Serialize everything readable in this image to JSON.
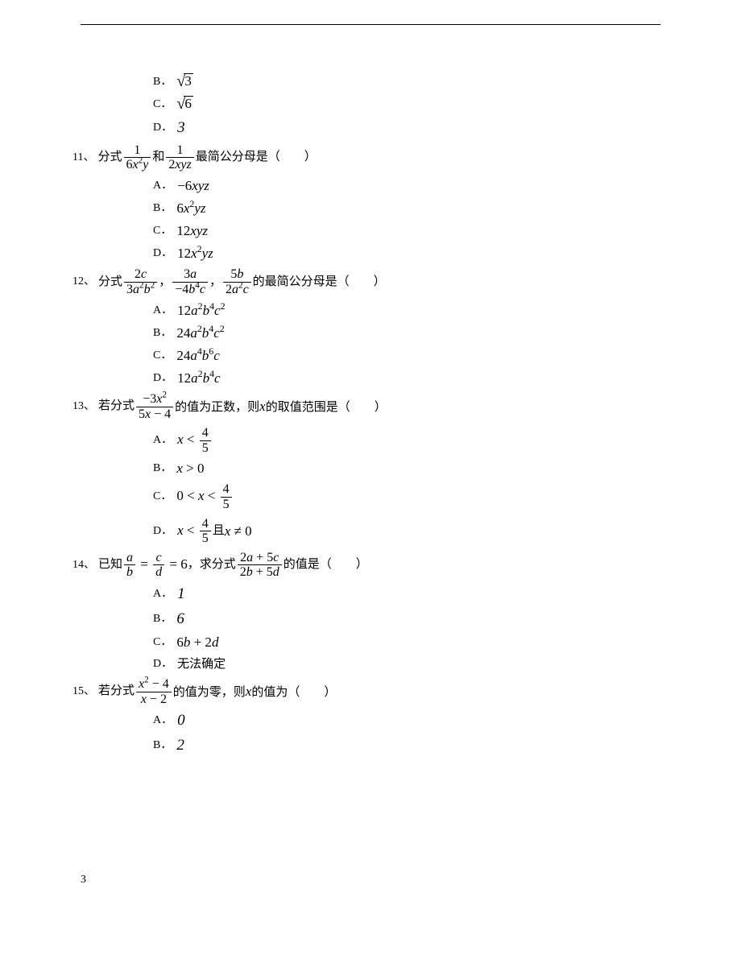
{
  "pageNumber": "3",
  "prev_options": {
    "B": "√3",
    "C": "√6",
    "D": "3"
  },
  "q11": {
    "num": "11、",
    "stem_pre": "分式",
    "frac1_num": "1",
    "frac1_den": "6x²y",
    "mid": "和",
    "frac2_num": "1",
    "frac2_den": "2xyz",
    "stem_post": "最简公分母是（　　）",
    "A": "−6xyz",
    "B": "6x²yz",
    "C": "12xyz",
    "D": "12x²yz"
  },
  "q12": {
    "num": "12、",
    "stem_pre": "分式",
    "f1n": "2c",
    "f1d": "3a²b²",
    "sep1": "，",
    "f2n": "3a",
    "f2d": "−4b⁴c",
    "sep2": "，",
    "f3n": "5b",
    "f3d": "2a²c",
    "stem_post": "的最简公分母是（　　）",
    "A": "12a²b⁴c²",
    "B": "24a²b⁴c²",
    "C": "24a⁴b⁶c",
    "D": "12a²b⁴c"
  },
  "q13": {
    "num": "13、",
    "stem_pre": "若分式",
    "fn": "−3x²",
    "fd": "5x − 4",
    "stem_post": "的值为正数，则x的取值范围是（　　）",
    "A_pre": "x < ",
    "A_fn": "4",
    "A_fd": "5",
    "B": "x > 0",
    "C_pre": "0 < x < ",
    "C_fn": "4",
    "C_fd": "5",
    "D_pre": "x < ",
    "D_fn": "4",
    "D_fd": "5",
    "D_post": "且x ≠ 0"
  },
  "q14": {
    "num": "14、",
    "stem_pre": "已知",
    "f1n": "a",
    "f1d": "b",
    "eq1": " = ",
    "f2n": "c",
    "f2d": "d",
    "eq2": " = 6，",
    "mid": "求分式",
    "f3n": "2a + 5c",
    "f3d": "2b + 5d",
    "stem_post": "的值是（　　）",
    "A": "1",
    "B": "6",
    "C": "6b + 2d",
    "D": "无法确定"
  },
  "q15": {
    "num": "15、",
    "stem_pre": "若分式",
    "fn": "x² − 4",
    "fd": "x − 2",
    "stem_post": "的值为零，则x的值为（　　）",
    "A": "0",
    "B": "2"
  }
}
